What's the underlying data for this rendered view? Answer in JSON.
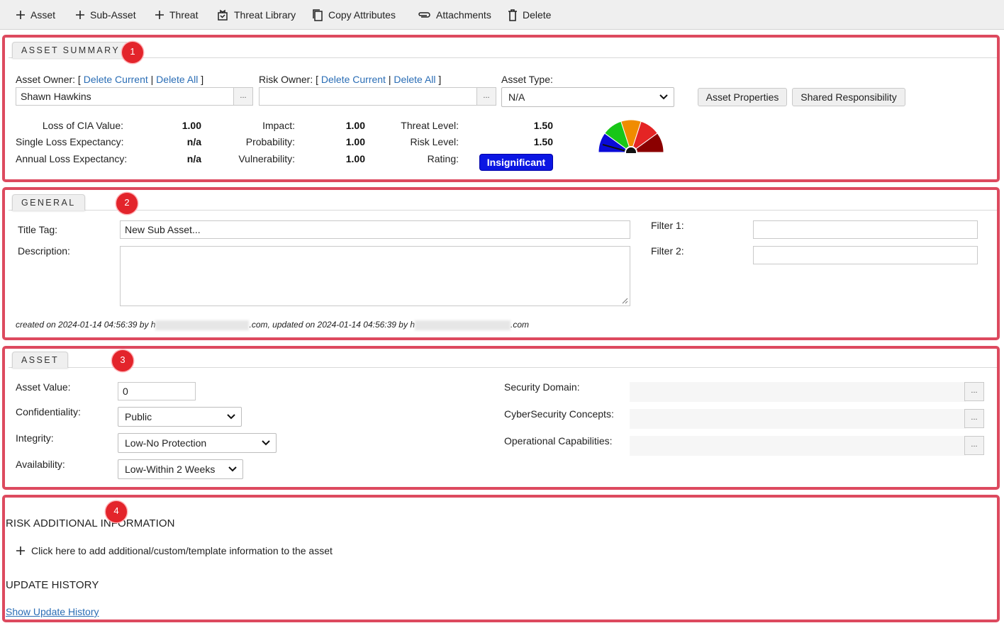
{
  "toolbar": {
    "asset": "Asset",
    "sub_asset": "Sub-Asset",
    "threat": "Threat",
    "threat_library": "Threat Library",
    "copy_attributes": "Copy Attributes",
    "attachments": "Attachments",
    "delete": "Delete"
  },
  "markers": [
    "1",
    "2",
    "3",
    "4"
  ],
  "summary": {
    "tab": "ASSET SUMMARY",
    "asset_owner_label": "Asset Owner: [",
    "risk_owner_label": "Risk Owner: [",
    "delete_current": "Delete Current",
    "sep": "|",
    "delete_all": "Delete All",
    "bracket_close": "]",
    "asset_owner_value": "Shawn Hawkins",
    "risk_owner_value": "",
    "dots": "...",
    "asset_type_label": "Asset Type:",
    "asset_type_value": "N/A",
    "asset_properties": "Asset Properties",
    "shared_responsibility": "Shared Responsibility",
    "loss_cia_label": "Loss of CIA Value:",
    "loss_cia_value": "1.00",
    "sle_label": "Single Loss Expectancy:",
    "sle_value": "n/a",
    "ale_label": "Annual Loss Expectancy:",
    "ale_value": "n/a",
    "impact_label": "Impact:",
    "impact_value": "1.00",
    "probability_label": "Probability:",
    "probability_value": "1.00",
    "vulnerability_label": "Vulnerability:",
    "vulnerability_value": "1.00",
    "threat_level_label": "Threat Level:",
    "threat_level_value": "1.50",
    "risk_level_label": "Risk Level:",
    "risk_level_value": "1.50",
    "rating_label": "Rating:",
    "rating_value": "Insignificant",
    "gauge_colors": [
      "#0a0ad8",
      "#18c618",
      "#f08c00",
      "#e42424",
      "#8b0000"
    ]
  },
  "general": {
    "tab": "GENERAL",
    "title_tag_label": "Title Tag:",
    "title_tag_value": "New Sub Asset...",
    "description_label": "Description:",
    "description_value": "",
    "filter1_label": "Filter 1:",
    "filter1_value": "",
    "filter2_label": "Filter 2:",
    "filter2_value": "",
    "meta_created": "created on 2024-01-14 04:56:39 by h",
    "meta_mid": ".com, updated on 2024-01-14 04:56:39 by h",
    "meta_end": ".com"
  },
  "asset": {
    "tab": "ASSET",
    "asset_value_label": "Asset Value:",
    "asset_value": "0",
    "confidentiality_label": "Confidentiality:",
    "confidentiality_value": "Public",
    "integrity_label": "Integrity:",
    "integrity_value": "Low-No Protection",
    "availability_label": "Availability:",
    "availability_value": "Low-Within 2 Weeks",
    "security_domain_label": "Security Domain:",
    "cyber_concepts_label": "CyberSecurity Concepts:",
    "operational_label": "Operational Capabilities:",
    "dots": "..."
  },
  "additional": {
    "risk_heading": "RISK ADDITIONAL INFORMATION",
    "add_custom": "Click here to add additional/custom/template information to the asset",
    "history_heading": "UPDATE HISTORY",
    "show_history": "Show Update History"
  }
}
